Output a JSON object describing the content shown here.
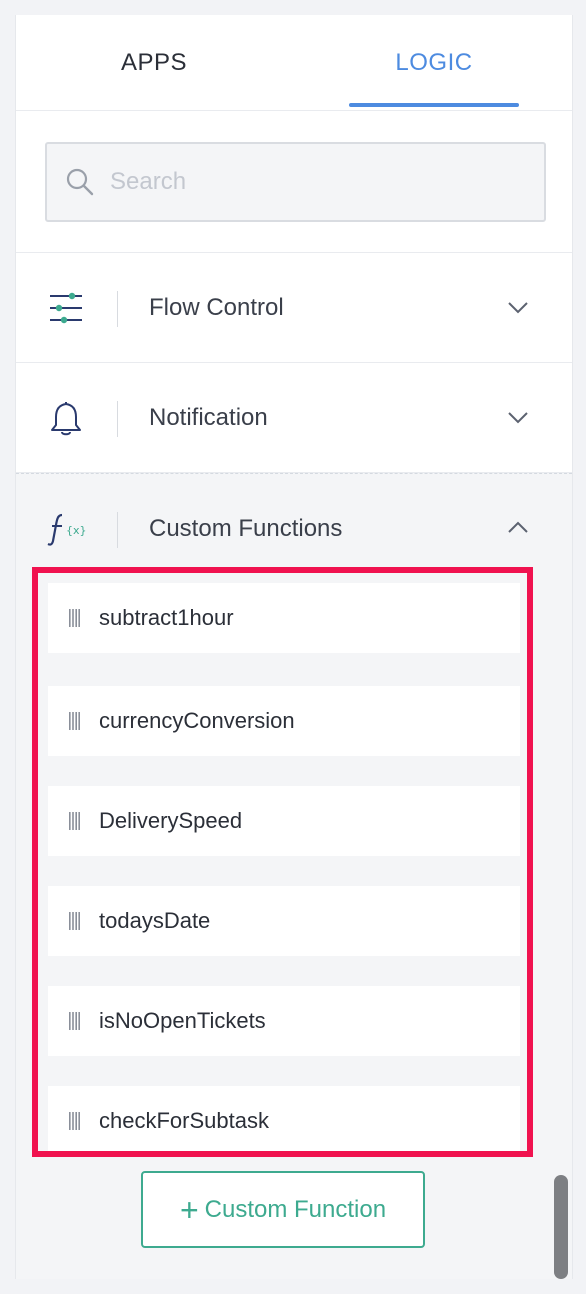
{
  "tabs": {
    "apps_label": "APPS",
    "logic_label": "LOGIC",
    "active": "logic"
  },
  "search": {
    "placeholder": "Search",
    "value": ""
  },
  "sections": {
    "flow_control": {
      "label": "Flow Control",
      "icon": "sliders-icon",
      "expanded": false
    },
    "notification": {
      "label": "Notification",
      "icon": "bell-icon",
      "expanded": false
    },
    "custom_functions": {
      "label": "Custom Functions",
      "icon": "function-icon",
      "expanded": true
    }
  },
  "custom_functions": [
    {
      "label": "subtract1hour"
    },
    {
      "label": "currencyConversion"
    },
    {
      "label": "DeliverySpeed"
    },
    {
      "label": "todaysDate"
    },
    {
      "label": "isNoOpenTickets"
    },
    {
      "label": "checkForSubtask"
    }
  ],
  "add_button": {
    "plus": "+",
    "label": "Custom Function"
  },
  "colors": {
    "accent_blue": "#4d8be0",
    "accent_green": "#3daa8f",
    "highlight_red": "#f0124f",
    "icon_navy": "#2a3a6e"
  }
}
